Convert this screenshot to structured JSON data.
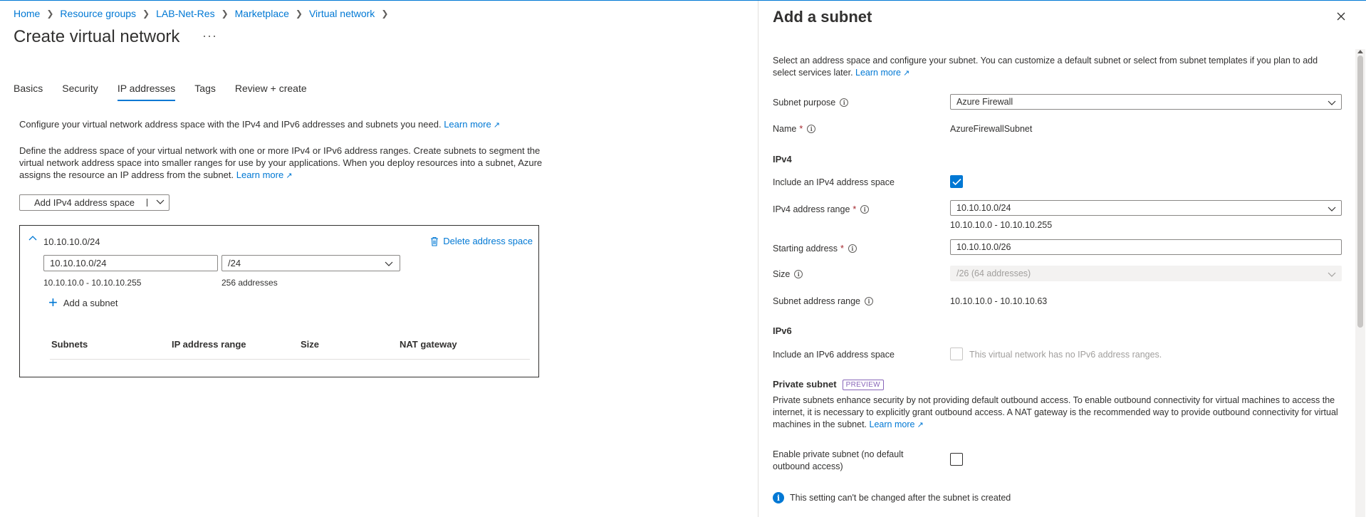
{
  "breadcrumb": [
    "Home",
    "Resource groups",
    "LAB-Net-Res",
    "Marketplace",
    "Virtual network"
  ],
  "page": {
    "title": "Create virtual network",
    "more": "···"
  },
  "tabs": [
    {
      "label": "Basics",
      "active": false
    },
    {
      "label": "Security",
      "active": false
    },
    {
      "label": "IP addresses",
      "active": true
    },
    {
      "label": "Tags",
      "active": false
    },
    {
      "label": "Review + create",
      "active": false
    }
  ],
  "intro": {
    "line1": "Configure your virtual network address space with the IPv4 and IPv6 addresses and subnets you need.",
    "line2": "Define the address space of your virtual network with one or more IPv4 or IPv6 address ranges. Create subnets to segment the virtual network address space into smaller ranges for use by your applications. When you deploy resources into a subnet, Azure assigns the resource an IP address from the subnet.",
    "learn_more": "Learn more"
  },
  "add_space_button": "Add IPv4 address space",
  "address_space": {
    "title": "10.10.10.0/24",
    "delete_label": "Delete address space",
    "address_value": "10.10.10.0/24",
    "size_value": "/24",
    "range": "10.10.10.0 - 10.10.10.255",
    "count": "256 addresses",
    "add_subnet": "Add a subnet",
    "columns": [
      "Subnets",
      "IP address range",
      "Size",
      "NAT gateway"
    ]
  },
  "panel": {
    "title": "Add a subnet",
    "intro": "Select an address space and configure your subnet. You can customize a default subnet or select from subnet templates if you plan to add select services later.",
    "learn_more": "Learn more",
    "subnet_purpose_label": "Subnet purpose",
    "subnet_purpose_value": "Azure Firewall",
    "name_label": "Name",
    "name_value": "AzureFirewallSubnet",
    "ipv4_heading": "IPv4",
    "include_ipv4_label": "Include an IPv4 address space",
    "include_ipv4_checked": true,
    "ipv4_range_label": "IPv4 address range",
    "ipv4_range_value": "10.10.10.0/24",
    "ipv4_range_hint": "10.10.10.0 - 10.10.10.255",
    "starting_address_label": "Starting address",
    "starting_address_value": "10.10.10.0/26",
    "size_label": "Size",
    "size_value": "/26 (64 addresses)",
    "subnet_range_label": "Subnet address range",
    "subnet_range_value": "10.10.10.0 - 10.10.10.63",
    "ipv6_heading": "IPv6",
    "include_ipv6_label": "Include an IPv6 address space",
    "include_ipv6_note": "This virtual network has no IPv6 address ranges.",
    "private_heading": "Private subnet",
    "preview_badge": "PREVIEW",
    "private_desc": "Private subnets enhance security by not providing default outbound access. To enable outbound connectivity for virtual machines to access the internet, it is necessary to explicitly grant outbound access. A NAT gateway is the recommended way to provide outbound connectivity for virtual machines in the subnet.",
    "enable_private_label": "Enable private subnet (no default outbound access)",
    "info_message": "This setting can't be changed after the subnet is created"
  },
  "colors": {
    "accent": "#0078d4",
    "text": "#323130",
    "required": "#a4262c",
    "preview": "#8764b8"
  },
  "icons": [
    "chevron-right-icon",
    "more-icon",
    "external-link-icon",
    "chevron-down-icon",
    "chevron-up-icon",
    "trash-icon",
    "plus-icon",
    "close-icon",
    "info-icon",
    "checkmark-icon"
  ]
}
